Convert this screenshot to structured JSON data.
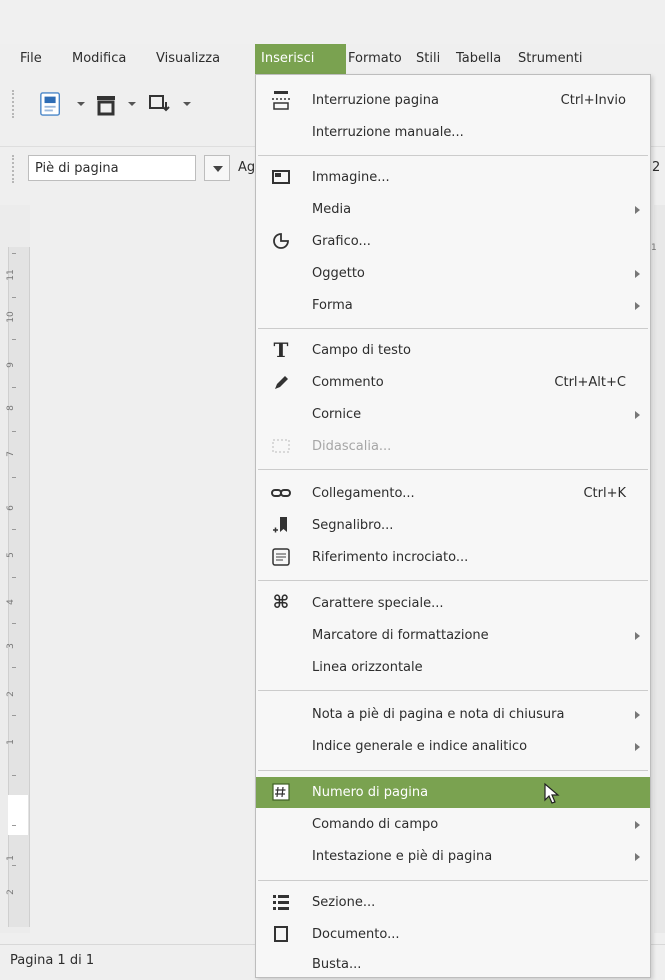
{
  "menubar": {
    "items": [
      "File",
      "Modifica",
      "Visualizza",
      "Inserisci",
      "Formato",
      "Stili",
      "Tabella",
      "Strumenti"
    ],
    "active": "Inserisci"
  },
  "toolbar": {
    "style_value": "Piè di pagina",
    "style_next": "Ag",
    "font_size_cut": "2",
    "ruler_cut": "1"
  },
  "ruler": {
    "labels": [
      "11",
      "10",
      "9",
      "8",
      "7",
      "6",
      "5",
      "4",
      "3",
      "2",
      "1",
      "1",
      "2"
    ]
  },
  "status": {
    "page": "Pagina 1 di 1"
  },
  "insert_menu": {
    "items": [
      {
        "label": "Interruzione pagina",
        "shortcut": "Ctrl+Invio",
        "icon": "page-break-icon"
      },
      {
        "label": "Interruzione manuale...",
        "icon": ""
      },
      {
        "label": "Immagine...",
        "icon": "image-icon"
      },
      {
        "label": "Media",
        "submenu": true,
        "icon": ""
      },
      {
        "label": "Grafico...",
        "icon": "chart-icon"
      },
      {
        "label": "Oggetto",
        "submenu": true,
        "icon": ""
      },
      {
        "label": "Forma",
        "submenu": true,
        "icon": ""
      },
      {
        "label": "Campo di testo",
        "icon": "text-box-icon"
      },
      {
        "label": "Commento",
        "shortcut": "Ctrl+Alt+C",
        "icon": "comment-pen-icon"
      },
      {
        "label": "Cornice",
        "submenu": true,
        "icon": ""
      },
      {
        "label": "Didascalia...",
        "disabled": true,
        "icon": "caption-icon"
      },
      {
        "label": "Collegamento...",
        "shortcut": "Ctrl+K",
        "icon": "link-icon"
      },
      {
        "label": "Segnalibro...",
        "icon": "bookmark-icon"
      },
      {
        "label": "Riferimento incrociato...",
        "icon": "cross-reference-icon"
      },
      {
        "label": "Carattere speciale...",
        "icon": "special-character-icon"
      },
      {
        "label": "Marcatore di formattazione",
        "submenu": true,
        "icon": ""
      },
      {
        "label": "Linea orizzontale",
        "icon": ""
      },
      {
        "label": "Nota a piè di pagina e nota di chiusura",
        "submenu": true,
        "icon": ""
      },
      {
        "label": "Indice generale e indice analitico",
        "submenu": true,
        "icon": ""
      },
      {
        "label": "Numero di pagina",
        "highlighted": true,
        "icon": "page-number-icon"
      },
      {
        "label": "Comando di campo",
        "submenu": true,
        "icon": ""
      },
      {
        "label": "Intestazione e piè di pagina",
        "submenu": true,
        "icon": ""
      },
      {
        "label": "Sezione...",
        "icon": "section-icon"
      },
      {
        "label": "Documento...",
        "icon": "document-icon"
      },
      {
        "label": "Busta...",
        "icon": ""
      }
    ]
  },
  "colors": {
    "accent": "#7aa250",
    "menu_bg": "#f7f7f7",
    "disabled_text": "#a6a6a6"
  }
}
